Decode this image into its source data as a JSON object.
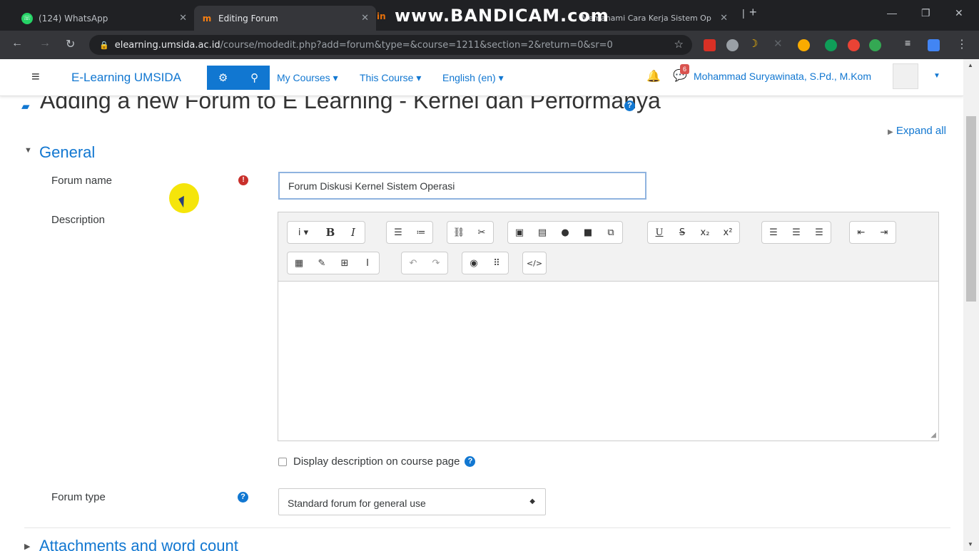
{
  "browser": {
    "tabs": [
      {
        "title": "(124) WhatsApp",
        "icon": "whatsapp-icon"
      },
      {
        "title": "Editing Forum",
        "icon": "moodle-icon"
      },
      {
        "title": "Memahami Cara Kerja Sistem Op",
        "icon": "moodle-icon"
      }
    ],
    "overlay_watermark_pre": "in",
    "overlay_watermark": "www.BANDICAM.com",
    "url_host": "elearning.umsida.ac.id",
    "url_path": "/course/modedit.php?add=forum&type=&course=1211&section=2&return=0&sr=0"
  },
  "navbar": {
    "brand": "E-Learning UMSIDA",
    "links": [
      "My Courses",
      "This Course",
      "English (en)"
    ],
    "message_count": "6",
    "username": "Mohammad Suryawinata, S.Pd., M.Kom"
  },
  "page": {
    "title": "Adding a new Forum to E Learning - Kernel dan Performanya",
    "expand_all": "Expand all",
    "section_general": "General",
    "forum_name_label": "Forum name",
    "forum_name_value": "Forum Diskusi Kernel Sistem Operasi",
    "description_label": "Description",
    "display_description_label": "Display description on course page",
    "forum_type_label": "Forum type",
    "forum_type_value": "Standard forum for general use",
    "section_attachments": "Attachments and word count"
  },
  "colors": {
    "accent": "#1177d1",
    "required": "#c9302c",
    "chrome_dark": "#202124"
  }
}
